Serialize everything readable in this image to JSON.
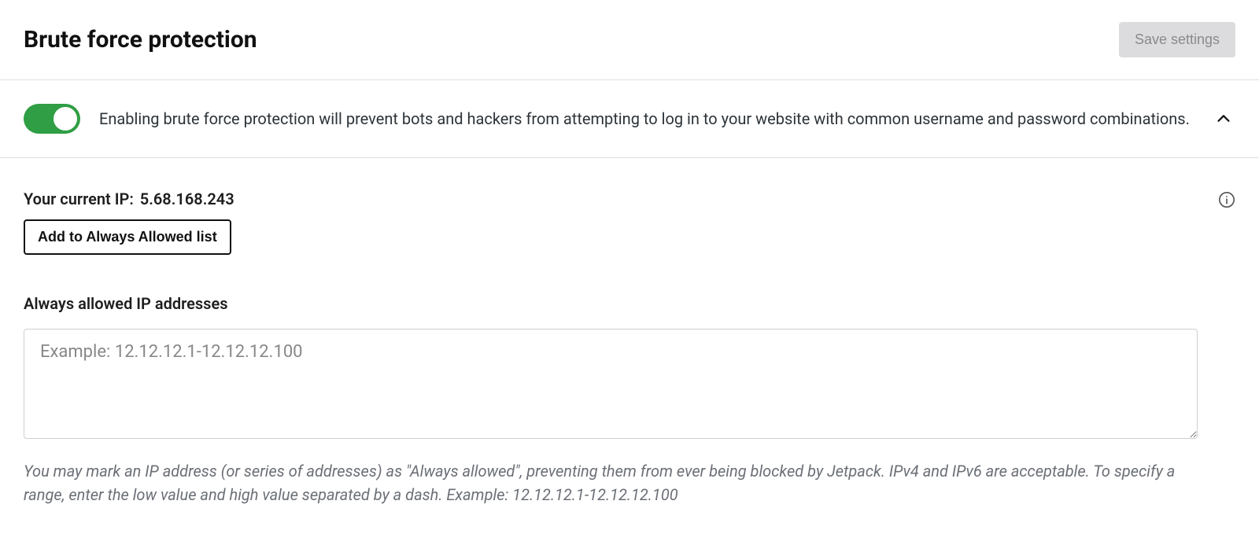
{
  "header": {
    "title": "Brute force protection",
    "save_label": "Save settings"
  },
  "toggle": {
    "description": "Enabling brute force protection will prevent bots and hackers from attempting to log in to your website with common username and password combinations.",
    "enabled": true
  },
  "ip": {
    "label_prefix": "Your current IP:",
    "current_ip": "5.68.168.243",
    "add_button_label": "Add to Always Allowed list"
  },
  "allowlist": {
    "heading": "Always allowed IP addresses",
    "placeholder": "Example: 12.12.12.1-12.12.12.100",
    "value": "",
    "help_text": "You may mark an IP address (or series of addresses) as \"Always allowed\", preventing them from ever being blocked by Jetpack. IPv4 and IPv6 are acceptable. To specify a range, enter the low value and high value separated by a dash. Example: 12.12.12.1-12.12.12.100"
  }
}
